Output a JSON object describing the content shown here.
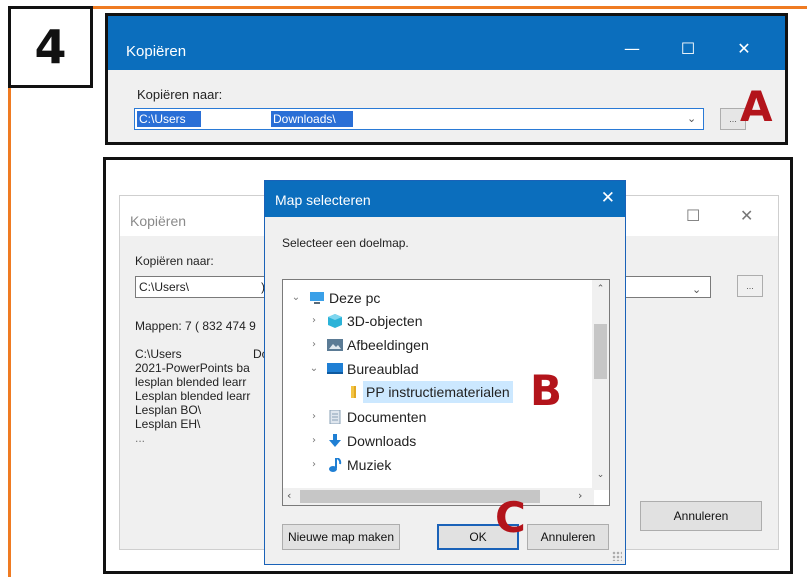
{
  "step": "4",
  "markers": {
    "a": "A",
    "b": "B",
    "c": "C"
  },
  "window_a": {
    "title": "Kopiëren",
    "label": "Kopiëren naar:",
    "path_part1": "C:\\Users",
    "path_part2": "Downloads\\",
    "browse_label": "..."
  },
  "window_b": {
    "title": "Kopiëren",
    "label": "Kopiëren naar:",
    "path_value": "C:\\Users\\",
    "path_fragment": ")",
    "browse_label": "...",
    "folders_info": "Mappen: 7   ( 832 474 9",
    "list": [
      "C:\\Users",
      "2021-PowerPoints ba",
      "lesplan blended learr",
      "Lesplan blended learr",
      "Lesplan BO\\",
      "Lesplan EH\\",
      "..."
    ],
    "list_fragment": "Dc",
    "cancel_label": "Annuleren"
  },
  "map_dialog": {
    "title": "Map selecteren",
    "instruction": "Selecteer een doelmap.",
    "tree": [
      {
        "label": "Deze pc",
        "expanded": true,
        "icon": "pc-icon"
      },
      {
        "label": "3D-objecten",
        "expanded": false,
        "icon": "3d-objects-icon"
      },
      {
        "label": "Afbeeldingen",
        "expanded": false,
        "icon": "pictures-icon"
      },
      {
        "label": "Bureaublad",
        "expanded": true,
        "icon": "desktop-icon"
      },
      {
        "label": "PP instructiematerialen",
        "selected": true,
        "icon": "folder-icon"
      },
      {
        "label": "Documenten",
        "expanded": false,
        "icon": "documents-icon"
      },
      {
        "label": "Downloads",
        "expanded": false,
        "icon": "downloads-icon"
      },
      {
        "label": "Muziek",
        "expanded": false,
        "icon": "music-icon"
      }
    ],
    "new_folder_label": "Nieuwe map maken",
    "ok_label": "OK",
    "cancel_label": "Annuleren"
  },
  "colors": {
    "accent": "#0b6ebd",
    "frame": "#ef7b22",
    "marker": "#b3141b",
    "selection": "#cce8ff"
  }
}
